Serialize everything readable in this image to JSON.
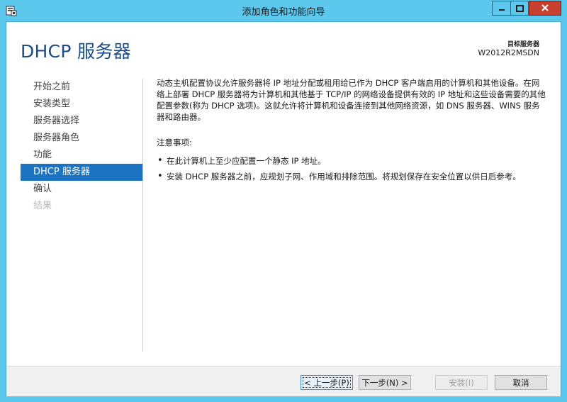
{
  "window": {
    "title": "添加角色和功能向导",
    "icon": "server-manager-wizard-icon",
    "controls": {
      "minimize": "minimize-icon",
      "maximize": "maximize-icon",
      "close": "close-icon"
    }
  },
  "header": {
    "page_title": "DHCP 服务器",
    "target_label": "目标服务器",
    "target_server": "W2012R2MSDN"
  },
  "nav": {
    "items": [
      {
        "label": "开始之前",
        "state": "normal"
      },
      {
        "label": "安装类型",
        "state": "normal"
      },
      {
        "label": "服务器选择",
        "state": "normal"
      },
      {
        "label": "服务器角色",
        "state": "normal"
      },
      {
        "label": "功能",
        "state": "normal"
      },
      {
        "label": "DHCP 服务器",
        "state": "active"
      },
      {
        "label": "确认",
        "state": "normal"
      },
      {
        "label": "结果",
        "state": "disabled"
      }
    ]
  },
  "content": {
    "intro": "动态主机配置协议允许服务器将 IP 地址分配或租用给已作为 DHCP 客户端启用的计算机和其他设备。在网络上部署 DHCP 服务器将为计算机和其他基于 TCP/IP 的网络设备提供有效的 IP 地址和这些设备需要的其他配置参数(称为 DHCP 选项)。这就允许将计算机和设备连接到其他网络资源，如 DNS 服务器、WINS 服务器和路由器。",
    "notes_heading": "注意事项:",
    "notes": [
      "在此计算机上至少应配置一个静态 IP 地址。",
      "安装 DHCP 服务器之前，应规划子网、作用域和排除范围。将规划保存在安全位置以供日后参考。"
    ]
  },
  "footer": {
    "prev_label": "< 上一步(P)",
    "next_label": "下一步(N) >",
    "install_label": "安装(I)",
    "cancel_label": "取消"
  },
  "colors": {
    "frame": "#5cc8ee",
    "title_text": "#1a4b86",
    "nav_active_bg": "#1b73c2",
    "close_button": "#c7402f"
  }
}
